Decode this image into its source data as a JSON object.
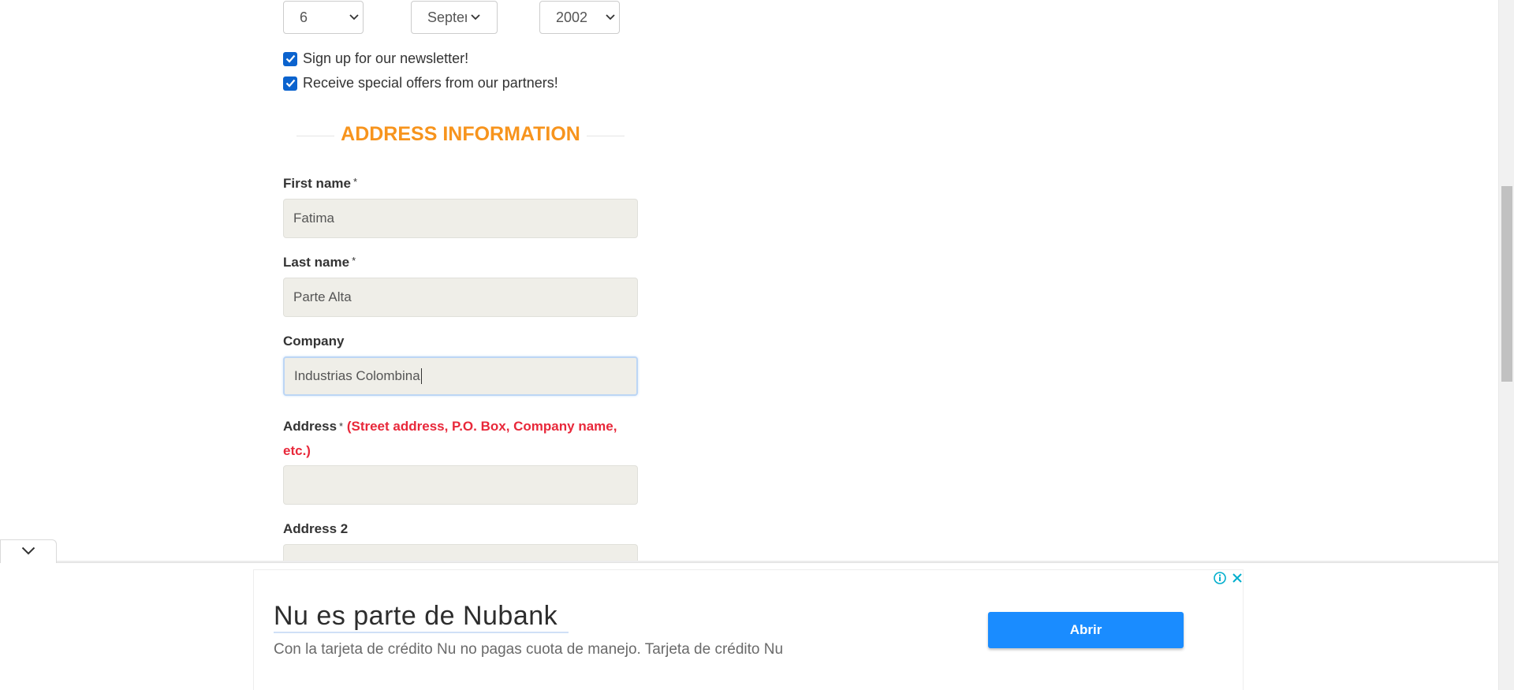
{
  "dob": {
    "day": "6",
    "month": "Septer",
    "year": "2002"
  },
  "options": {
    "newsletter_label": "Sign up for our newsletter!",
    "offers_label": "Receive special offers from our partners!"
  },
  "section": {
    "title": "ADDRESS INFORMATION"
  },
  "form": {
    "first_name_label": "First name",
    "first_name_value": "Fatima",
    "last_name_label": "Last name",
    "last_name_value": "Parte Alta",
    "company_label": "Company",
    "company_value": "Industrias Colombina",
    "address_label": "Address",
    "address_hint_line1": "(Street address, P.O. Box, Company name,",
    "address_hint_line2": "etc.)",
    "address_value": "",
    "address2_label": "Address 2",
    "required_mark": "*"
  },
  "ad": {
    "headline": "Nu es parte de Nubank",
    "description": "Con la tarjeta de crédito Nu no pagas cuota de manejo. Tarjeta de crédito Nu",
    "button_label": "Abrir"
  },
  "colors": {
    "accent_orange": "#f7941d",
    "hint_red": "#e8283a",
    "checkbox_blue": "#0b63ce",
    "ad_button_blue": "#1a8cff",
    "input_bg": "#efeee8"
  }
}
